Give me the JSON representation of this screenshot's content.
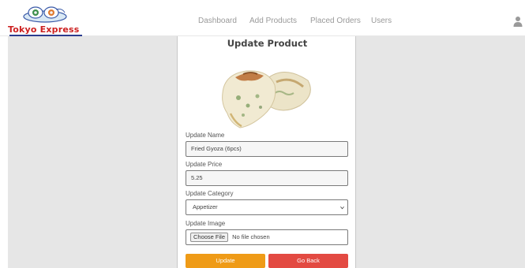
{
  "brand": {
    "name": "Tokyo Express"
  },
  "nav": {
    "items": [
      {
        "label": "Dashboard"
      },
      {
        "label": "Add Products"
      },
      {
        "label": "Placed Orders"
      },
      {
        "label": "Users"
      }
    ],
    "user_icon": "user-icon"
  },
  "form": {
    "title": "Update Product",
    "image_icon": "fried-gyoza-photo",
    "name": {
      "label": "Update Name",
      "value": "Fried Gyoza (6pcs)"
    },
    "price": {
      "label": "Update Price",
      "value": "5.25"
    },
    "category": {
      "label": "Update Category",
      "value": "Appetizer"
    },
    "image": {
      "label": "Update Image",
      "button": "Choose File",
      "status": "No file chosen"
    },
    "buttons": {
      "update": "Update",
      "back": "Go Back"
    }
  },
  "colors": {
    "brand_red": "#cc1f1f",
    "brand_blue": "#2a3b8f",
    "update_button": "#ef9b17",
    "back_button": "#e34a42",
    "page_background": "#e6e6e6"
  }
}
